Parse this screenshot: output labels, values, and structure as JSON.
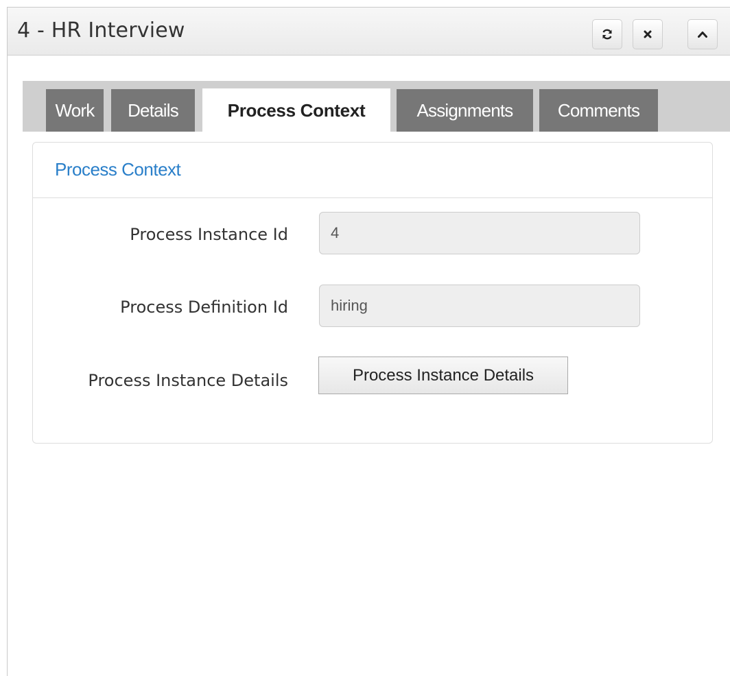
{
  "window": {
    "title": "4 - HR Interview",
    "buttons": {
      "refresh_icon": "refresh-icon",
      "close_icon": "close-icon",
      "collapse_icon": "chevron-up-icon"
    }
  },
  "tabs": [
    {
      "label": "Work",
      "active": false
    },
    {
      "label": "Details",
      "active": false
    },
    {
      "label": "Process Context",
      "active": true
    },
    {
      "label": "Assignments",
      "active": false
    },
    {
      "label": "Comments",
      "active": false
    }
  ],
  "panel": {
    "title": "Process Context",
    "fields": [
      {
        "label": "Process Instance Id",
        "value": "4"
      },
      {
        "label": "Process Definition Id",
        "value": "hiring"
      }
    ],
    "details": {
      "label": "Process Instance Details",
      "button_label": "Process Instance Details"
    }
  },
  "colors": {
    "accent": "#2a7fc9",
    "tab_inactive": "#777777",
    "tab_strip": "#cfcfcf",
    "field_bg": "#eeeeee"
  }
}
